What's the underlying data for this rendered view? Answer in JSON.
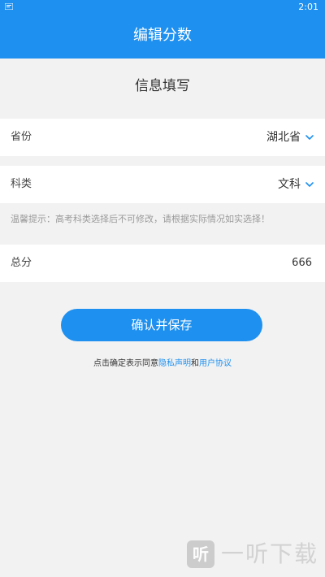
{
  "status_bar": {
    "time": "2:01"
  },
  "app_bar": {
    "title": "编辑分数"
  },
  "form": {
    "section_title": "信息填写",
    "province": {
      "label": "省份",
      "value": "湖北省"
    },
    "subject": {
      "label": "科类",
      "value": "文科"
    },
    "hint": "温馨提示：高考科类选择后不可修改，请根据实际情况如实选择！",
    "total_score": {
      "label": "总分",
      "value": "666"
    }
  },
  "actions": {
    "confirm_label": "确认并保存"
  },
  "agreement": {
    "prefix": "点击确定表示同意",
    "privacy_link": "隐私声明",
    "conjunction": "和",
    "terms_link": "用户协议"
  },
  "watermark": {
    "logo_text": "听",
    "text": "一听下载"
  },
  "colors": {
    "accent": "#1e90f0",
    "background": "#f2f2f2",
    "card": "#ffffff",
    "hint": "#9a9a9a"
  },
  "icons": {
    "status_left": "notification-icon",
    "chevron": "chevron-down-icon"
  }
}
